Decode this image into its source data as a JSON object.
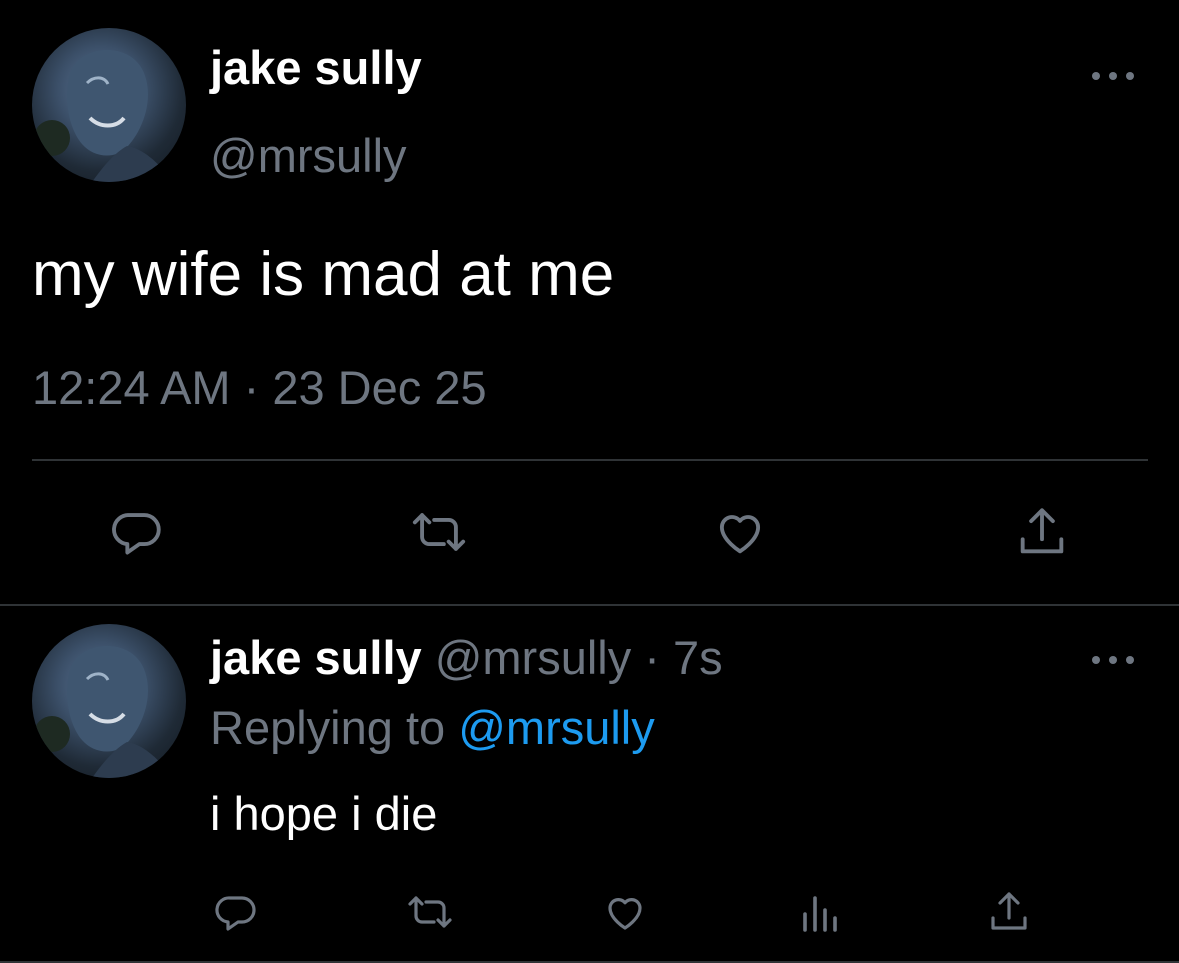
{
  "colors": {
    "background": "#000000",
    "primary_text": "#ffffff",
    "secondary_text": "#6e7681",
    "accent": "#1d9bf0",
    "divider": "#2f3336"
  },
  "main_tweet": {
    "name": "jake sully",
    "handle": "@mrsully",
    "text": "my wife is mad at me",
    "timestamp": "12:24 AM · 23 Dec 25",
    "more_icon": "more-dots-icon",
    "actions": [
      {
        "icon": "reply-icon"
      },
      {
        "icon": "retweet-icon"
      },
      {
        "icon": "like-icon"
      },
      {
        "icon": "share-icon"
      }
    ]
  },
  "reply_tweet": {
    "name": "jake sully",
    "meta": " @mrsully · 7s",
    "replying_prefix": "Replying to ",
    "replying_handle": "@mrsully",
    "text": "i hope i die",
    "more_icon": "more-dots-icon",
    "actions": [
      {
        "icon": "reply-icon"
      },
      {
        "icon": "retweet-icon"
      },
      {
        "icon": "like-icon"
      },
      {
        "icon": "analytics-icon"
      },
      {
        "icon": "share-icon"
      }
    ]
  }
}
